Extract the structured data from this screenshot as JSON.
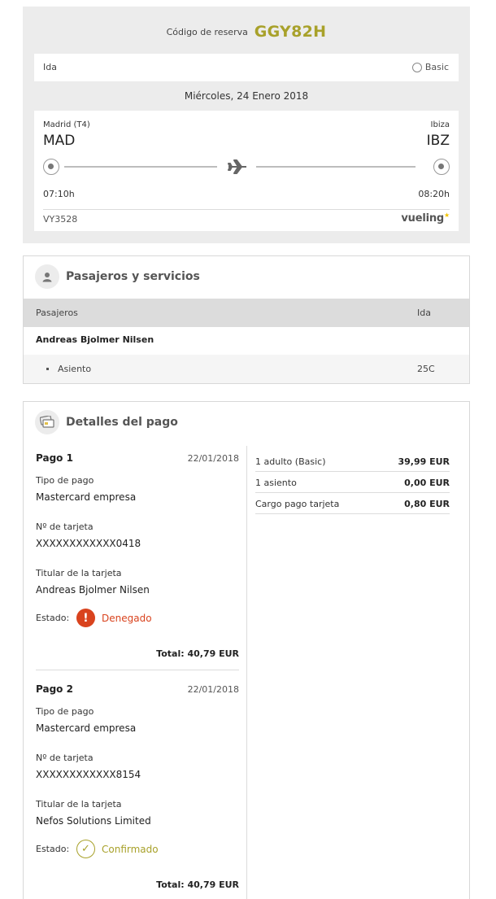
{
  "booking": {
    "code_label": "Código de reserva",
    "code": "GGY82H",
    "direction": "Ida",
    "fare": "Basic",
    "date": "Miércoles, 24 Enero 2018",
    "origin_city": "Madrid (T4)",
    "origin_code": "MAD",
    "dest_city": "Ibiza",
    "dest_code": "IBZ",
    "departure": "07:10h",
    "arrival": "08:20h",
    "flight_number": "VY3528",
    "airline": "vueling",
    "colors": {
      "accent": "#a8a12a",
      "denied": "#d9431e",
      "panel": "#ececec"
    }
  },
  "passengers": {
    "title": "Pasajeros y servicios",
    "icon": "person-icon",
    "col_passengers": "Pasajeros",
    "col_direction": "Ida",
    "name": "Andreas Bjolmer Nilsen",
    "service": "Asiento",
    "seat": "25C"
  },
  "payment": {
    "title": "Detalles del pago",
    "icon": "credit-card-icon",
    "pagos": [
      {
        "title": "Pago 1",
        "date": "22/01/2018",
        "type_label": "Tipo de pago",
        "type": "Mastercard empresa",
        "card_label": "Nº de tarjeta",
        "card": "XXXXXXXXXXXX0418",
        "holder_label": "Titular de la tarjeta",
        "holder": "Andreas Bjolmer Nilsen",
        "status_label": "Estado:",
        "status": "Denegado",
        "total": "Total: 40,79 EUR"
      },
      {
        "title": "Pago 2",
        "date": "22/01/2018",
        "type_label": "Tipo de pago",
        "type": "Mastercard empresa",
        "card_label": "Nº de tarjeta",
        "card": "XXXXXXXXXXXX8154",
        "holder_label": "Titular de la tarjeta",
        "holder": "Nefos Solutions Limited",
        "status_label": "Estado:",
        "status": "Confirmado",
        "total": "Total: 40,79 EUR"
      }
    ],
    "summary": [
      {
        "label": "1 adulto (Basic)",
        "amount": "39,99 EUR"
      },
      {
        "label": "1 asiento",
        "amount": "0,00 EUR"
      },
      {
        "label": "Cargo pago tarjeta",
        "amount": "0,80 EUR"
      }
    ]
  }
}
